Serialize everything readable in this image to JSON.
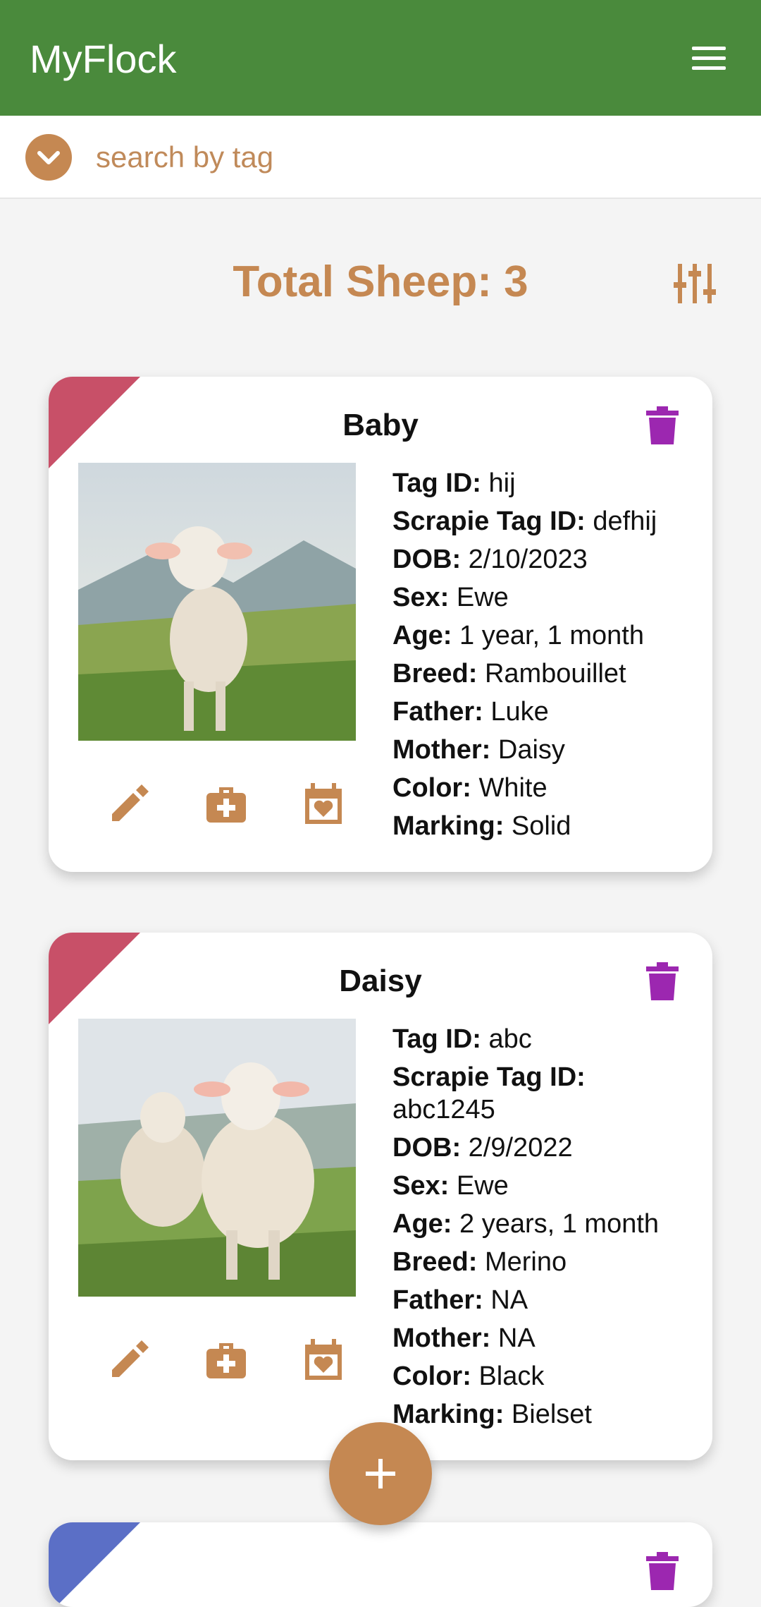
{
  "app": {
    "title": "MyFlock"
  },
  "search": {
    "placeholder": "search by tag"
  },
  "summary": {
    "total_label": "Total Sheep: 3"
  },
  "colors": {
    "appbar": "#4a8a3c",
    "accent": "#c58852",
    "trash": "#9c27b0",
    "corner_red": "#c85068",
    "corner_blue": "#5b6fc6"
  },
  "icons": {
    "menu": "menu-icon",
    "expand": "chevron-down-icon",
    "filter": "tune-icon",
    "delete": "trash-icon",
    "edit": "pencil-icon",
    "medical": "medical-bag-icon",
    "calendar": "calendar-heart-icon",
    "add": "plus-icon"
  },
  "labels": {
    "tag_id": "Tag ID:",
    "scrapie": "Scrapie Tag ID:",
    "dob": "DOB:",
    "sex": "Sex:",
    "age": "Age:",
    "breed": "Breed:",
    "father": "Father:",
    "mother": "Mother:",
    "color": "Color:",
    "marking": "Marking:"
  },
  "sheep": [
    {
      "name": "Baby",
      "tag_id": "hij",
      "scrapie_tag_id": "defhij",
      "dob": "2/10/2023",
      "sex": "Ewe",
      "age": "1 year, 1 month",
      "breed": "Rambouillet",
      "father": "Luke",
      "mother": "Daisy",
      "color": "White",
      "marking": "Solid"
    },
    {
      "name": "Daisy",
      "tag_id": "abc",
      "scrapie_tag_id": "abc1245",
      "dob": "2/9/2022",
      "sex": "Ewe",
      "age": "2 years, 1 month",
      "breed": "Merino",
      "father": "NA",
      "mother": "NA",
      "color": "Black",
      "marking": "Bielset"
    }
  ]
}
